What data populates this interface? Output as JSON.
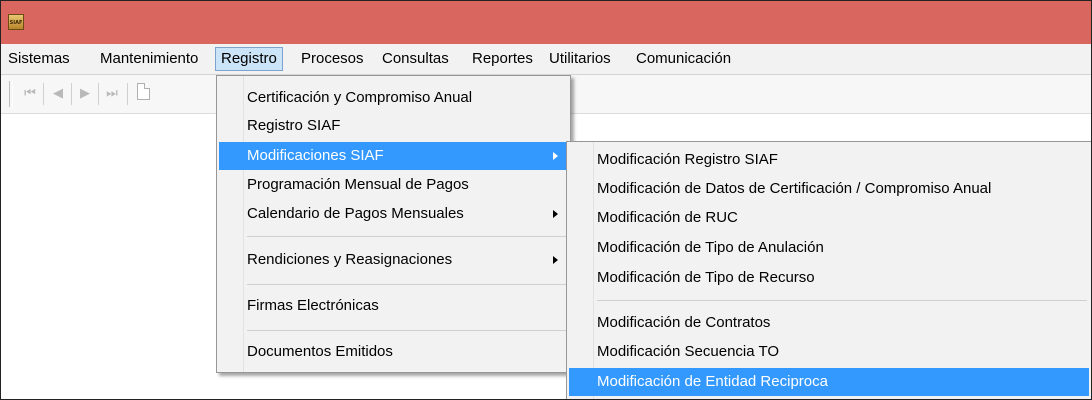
{
  "window": {
    "icon_text": "SIAF"
  },
  "menubar": {
    "items": [
      "Sistemas",
      "Mantenimiento",
      "Registro",
      "Procesos",
      "Consultas",
      "Reportes",
      "Utilitarios",
      "Comunicación"
    ]
  },
  "registro_menu": {
    "items": [
      "Certificación y Compromiso Anual",
      "Registro SIAF",
      "Modificaciones SIAF",
      "Programación Mensual de Pagos",
      "Calendario de Pagos Mensuales",
      "Rendiciones y Reasignaciones",
      "Firmas Electrónicas",
      "Documentos Emitidos"
    ],
    "highlighted": "Modificaciones SIAF"
  },
  "modificaciones_submenu": {
    "items": [
      "Modificación Registro SIAF",
      "Modificación de Datos de Certificación / Compromiso Anual",
      "Modificación de RUC",
      "Modificación de Tipo de Anulación",
      "Modificación de Tipo de Recurso",
      "Modificación de Contratos",
      "Modificación Secuencia TO",
      "Modificación de Entidad Reciproca"
    ],
    "highlighted": "Modificación de Entidad Reciproca"
  },
  "colors": {
    "titlebar": "#d9675f",
    "highlight": "#3399ff",
    "menu_open": "#cce4f7"
  },
  "icons": [
    "app-siaf-icon",
    "first-record-icon",
    "previous-record-icon",
    "next-record-icon",
    "last-record-icon",
    "new-document-icon",
    "submenu-arrow-icon"
  ]
}
